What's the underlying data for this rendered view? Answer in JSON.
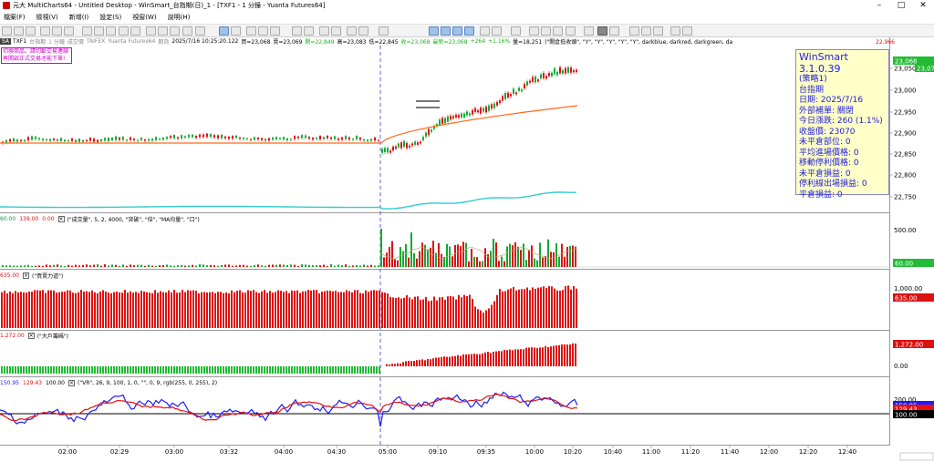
{
  "window": {
    "title": "元大 MultiCharts64 - Untitled Desktop - WinSmart_台指期(日)_1 - [TXF1 - 1 分鐘 - Yuanta Futures64]",
    "minimize_icon": "minimize-icon",
    "maximize_icon": "maximize-icon",
    "close_icon": "close-icon"
  },
  "menu": {
    "items": [
      "檔案(F)",
      "檢視(V)",
      "新增(I)",
      "設定(S)",
      "視窗(W)",
      "說明(H)"
    ]
  },
  "chart_info": {
    "badge": "SA",
    "symbol": "TXF1",
    "name": "台指期",
    "interval": "1 分鐘",
    "volume_label": "成交價",
    "exchange": "TAIFEX",
    "source": "Yuanta Futures64",
    "period_label": "期貨",
    "datetime": "2025/7/16  10:25:20.122",
    "bid": "買=23,068",
    "ask": "賣=23,069",
    "open": "開=22,849",
    "high": "高=23,083",
    "low": "低=22,845",
    "close": "收=23,068",
    "last": "最新=23,068",
    "change": "+264",
    "change_pct": "+1.16%",
    "qty": "量=18,251",
    "strategy": "(\"開倉低收頭\", \"Y\", \"Y\", \"Y\", \"Y\", \"Y\", darkblue, darkred, darkgreen, da"
  },
  "notice": {
    "line1": "切換商品，請切斷交易連線",
    "line2": "再開啟正式交易才能下單!"
  },
  "winsmart": {
    "title": "WinSmart 3.1.0.39",
    "lines": [
      "(策略1)",
      "台指期",
      "日期: 2025/7/16",
      "外部補單: 關閉",
      "今日漲跌: 260 (1.1%)",
      "收盤價: 23070",
      "未平倉部位: 0",
      "平均進場價格: 0",
      "移動停利價格: 0",
      "未平倉損益: 0",
      "停利線出場損益: 0",
      "平倉損益: 0"
    ]
  },
  "panes": {
    "price": {
      "y_top_label": "22,966",
      "last_label": "23,068",
      "cursor_label": "23,071",
      "y_ticks": [
        "23,050",
        "23,000",
        "22,950",
        "22,900",
        "22,850",
        "22,800",
        "22,750"
      ]
    },
    "volume": {
      "values": [
        "60.00",
        "139.00",
        "0.00"
      ],
      "desc": "(\"成交量\", 5, 2, 4000, \"突破\", \"倍\", \"MA均量\", \"口\")",
      "y_ticks": [
        "500.00"
      ],
      "last_label": "60.00"
    },
    "power": {
      "values": [
        "635.00"
      ],
      "desc": "(\"買賣力道\")",
      "y_ticks": [
        "1,000.00"
      ],
      "last_label": "635.00"
    },
    "big": {
      "values": [
        "1,272.00"
      ],
      "desc": "(\"大戶籌碼\")",
      "y_ticks": [
        "0.00"
      ],
      "last_label": "1,272.00"
    },
    "vr": {
      "values": [
        "150.95",
        "129.43",
        "100.00"
      ],
      "desc": "(\"VR\", 26, 9, 100, 1, 0, \"\", 0, 9, rgb(255, 0, 255), 2)",
      "y_ticks": [
        "200.00"
      ],
      "last_labels": [
        "150.95",
        "129.43",
        "100.00"
      ]
    }
  },
  "time_axis": [
    "02:00",
    "02:29",
    "03:00",
    "03:32",
    "04:00",
    "04:30",
    "05:00",
    "09:10",
    "09:35",
    "10:00",
    "10:20",
    "10:40",
    "11:00",
    "11:20",
    "11:40",
    "12:00",
    "12:20",
    "12:40"
  ],
  "colors": {
    "up": "#dd1111",
    "down": "#11aa33",
    "ma_orange": "#ff6a1a",
    "cyan": "#33cccc",
    "vr_blue": "#1c1cff",
    "vr_red": "#e81010",
    "ws_text": "#2020e0"
  }
}
